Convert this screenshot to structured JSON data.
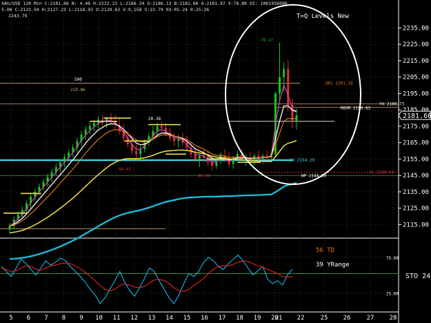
{
  "header": {
    "line1": "XAU/USD 120 Min  C:2181.66  N: 4.46  H:2222.22  L:2166.34  O:2186.13  B:2181.66  A:2181.97  V:78.8K  OI: 1061956096",
    "line2": "5.00  C:2123.59  H:2127.23  L:2118.93  O:2120.63  V:9,158  S:23.79  03-05-24  0:25:26",
    "price_hi": "2243.79"
  },
  "annotation": {
    "title": "T=Q Levels New"
  },
  "colors": {
    "background": "#000000",
    "up_candle": "#19c519",
    "down_candle": "#e03030",
    "ma_magenta": "#d040c0",
    "ma_white": "#f2f2f2",
    "ma_orange": "#e07818",
    "ma_yellow": "#e6d84a",
    "ma_cyan": "#1eb8d8",
    "stoch_fast": "#1aa8d8",
    "stoch_slow": "#d82020",
    "level_cyan": "#3fd8e8",
    "level_tan": "#c9a868",
    "level_green": "#3a8a3a"
  },
  "chart_data": [
    {
      "type": "candlestick",
      "title": "",
      "ylim": [
        2108,
        2247
      ],
      "y_ticks": [
        2115.0,
        2125.0,
        2135.0,
        2145.0,
        2155.0,
        2165.0,
        2175.0,
        2185.0,
        2195.0,
        2205.0,
        2215.0,
        2225.0,
        2235.0
      ],
      "last_price": "2181.66",
      "x_ticks": [
        "5",
        "6",
        "7",
        "8",
        "9",
        "10",
        "11",
        "12",
        "13",
        "14",
        "15",
        "16",
        "17",
        "18",
        "19",
        "20",
        "21",
        "22",
        "25",
        "26",
        "27",
        "28"
      ],
      "ohlc": [
        [
          2112,
          2116,
          2110,
          2114
        ],
        [
          2114,
          2120,
          2112,
          2118
        ],
        [
          2118,
          2123,
          2116,
          2121
        ],
        [
          2121,
          2126,
          2119,
          2124
        ],
        [
          2124,
          2130,
          2122,
          2128
        ],
        [
          2128,
          2134,
          2125,
          2132
        ],
        [
          2132,
          2137,
          2129,
          2135
        ],
        [
          2135,
          2140,
          2133,
          2138
        ],
        [
          2138,
          2143,
          2136,
          2141
        ],
        [
          2141,
          2146,
          2138,
          2144
        ],
        [
          2144,
          2149,
          2141,
          2147
        ],
        [
          2147,
          2152,
          2145,
          2150
        ],
        [
          2150,
          2155,
          2147,
          2153
        ],
        [
          2153,
          2158,
          2150,
          2156
        ],
        [
          2156,
          2161,
          2154,
          2159
        ],
        [
          2159,
          2164,
          2156,
          2162
        ],
        [
          2162,
          2168,
          2159,
          2166
        ],
        [
          2166,
          2172,
          2163,
          2170
        ],
        [
          2170,
          2175,
          2167,
          2173
        ],
        [
          2173,
          2177,
          2170,
          2175
        ],
        [
          2175,
          2179,
          2172,
          2177
        ],
        [
          2177,
          2181,
          2174,
          2179
        ],
        [
          2179,
          2182,
          2175,
          2178
        ],
        [
          2178,
          2181,
          2174,
          2180
        ],
        [
          2180,
          2183,
          2176,
          2178
        ],
        [
          2178,
          2182,
          2173,
          2176
        ],
        [
          2176,
          2180,
          2170,
          2172
        ],
        [
          2172,
          2176,
          2166,
          2168
        ],
        [
          2168,
          2172,
          2162,
          2164
        ],
        [
          2164,
          2168,
          2158,
          2160
        ],
        [
          2160,
          2164,
          2154,
          2158
        ],
        [
          2158,
          2163,
          2154,
          2161
        ],
        [
          2161,
          2167,
          2159,
          2165
        ],
        [
          2165,
          2171,
          2163,
          2169
        ],
        [
          2169,
          2175,
          2166,
          2172
        ],
        [
          2172,
          2177,
          2169,
          2175
        ],
        [
          2175,
          2178,
          2171,
          2174
        ],
        [
          2174,
          2177,
          2169,
          2171
        ],
        [
          2171,
          2174,
          2166,
          2168
        ],
        [
          2168,
          2171,
          2163,
          2166
        ],
        [
          2166,
          2170,
          2162,
          2167
        ],
        [
          2167,
          2171,
          2163,
          2165
        ],
        [
          2165,
          2169,
          2160,
          2162
        ],
        [
          2162,
          2165,
          2156,
          2158
        ],
        [
          2158,
          2162,
          2153,
          2155
        ],
        [
          2155,
          2159,
          2150,
          2157
        ],
        [
          2157,
          2161,
          2153,
          2156
        ],
        [
          2156,
          2160,
          2151,
          2153
        ],
        [
          2153,
          2157,
          2148,
          2151
        ],
        [
          2151,
          2156,
          2149,
          2154
        ],
        [
          2154,
          2159,
          2152,
          2157
        ],
        [
          2157,
          2161,
          2153,
          2155
        ],
        [
          2155,
          2159,
          2150,
          2152
        ],
        [
          2152,
          2157,
          2149,
          2156
        ],
        [
          2156,
          2160,
          2153,
          2158
        ],
        [
          2158,
          2161,
          2154,
          2155
        ],
        [
          2155,
          2158,
          2151,
          2156
        ],
        [
          2156,
          2159,
          2152,
          2154
        ],
        [
          2154,
          2158,
          2151,
          2157
        ],
        [
          2157,
          2160,
          2153,
          2155
        ],
        [
          2155,
          2158,
          2152,
          2157
        ],
        [
          2157,
          2160,
          2154,
          2156
        ],
        [
          2156,
          2159,
          2153,
          2158
        ],
        [
          2158,
          2196,
          2157,
          2195
        ],
        [
          2195,
          2226,
          2190,
          2205
        ],
        [
          2205,
          2214,
          2196,
          2210
        ],
        [
          2210,
          2215,
          2184,
          2188
        ],
        [
          2188,
          2192,
          2174,
          2178
        ],
        [
          2178,
          2186,
          2173,
          2181.66
        ]
      ],
      "levels": [
        {
          "label": "500",
          "value": 2201.5
        },
        {
          "label": "210.86",
          "value": 2199.0
        },
        {
          "label": "QR1 2201.28",
          "value": 2201.28
        },
        {
          "label": "YH 2188.73",
          "value": 2188.73
        },
        {
          "label": "RDVR 2186.62",
          "value": 2186.62
        },
        {
          "label": "20.38",
          "value": 2178.0
        },
        {
          "label": "YO 2154.29",
          "value": 2154.29
        },
        {
          "label": "YL 2146.93",
          "value": 2146.93
        },
        {
          "label": "WP 2144.80",
          "value": 2144.8
        },
        {
          "label": "44.43",
          "value": 2148.0
        },
        {
          "label": "45.38",
          "value": 2144.0
        },
        {
          "label": "78.27",
          "value": 2225.0
        }
      ]
    },
    {
      "type": "line",
      "title": "",
      "ylim": [
        0,
        100
      ],
      "y_ticks": [
        "75.00",
        "25.00"
      ],
      "labels": [
        "56 TD",
        "39 YRange",
        "STO 24"
      ],
      "series": [
        {
          "values": [
            62,
            55,
            48,
            60,
            72,
            66,
            58,
            50,
            60,
            70,
            64,
            68,
            74,
            70,
            62,
            55,
            48,
            40,
            30,
            22,
            10,
            18,
            30,
            42,
            55,
            40,
            28,
            20,
            32,
            45,
            60,
            55,
            42,
            30,
            18,
            10,
            22,
            38,
            52,
            48,
            55,
            68,
            75,
            70,
            62,
            58,
            66,
            72,
            78,
            70,
            60,
            50,
            56,
            62,
            44,
            38,
            42,
            36,
            50,
            58
          ]
        },
        {
          "values": [
            60,
            58,
            55,
            56,
            60,
            63,
            62,
            58,
            57,
            60,
            63,
            64,
            66,
            67,
            66,
            63,
            59,
            54,
            48,
            42,
            35,
            30,
            28,
            30,
            35,
            38,
            36,
            33,
            32,
            34,
            39,
            43,
            44,
            42,
            38,
            32,
            28,
            27,
            30,
            35,
            40,
            45,
            52,
            58,
            62,
            63,
            63,
            65,
            68,
            70,
            69,
            66,
            63,
            61,
            58,
            55,
            52,
            48,
            47,
            48
          ]
        }
      ]
    }
  ]
}
